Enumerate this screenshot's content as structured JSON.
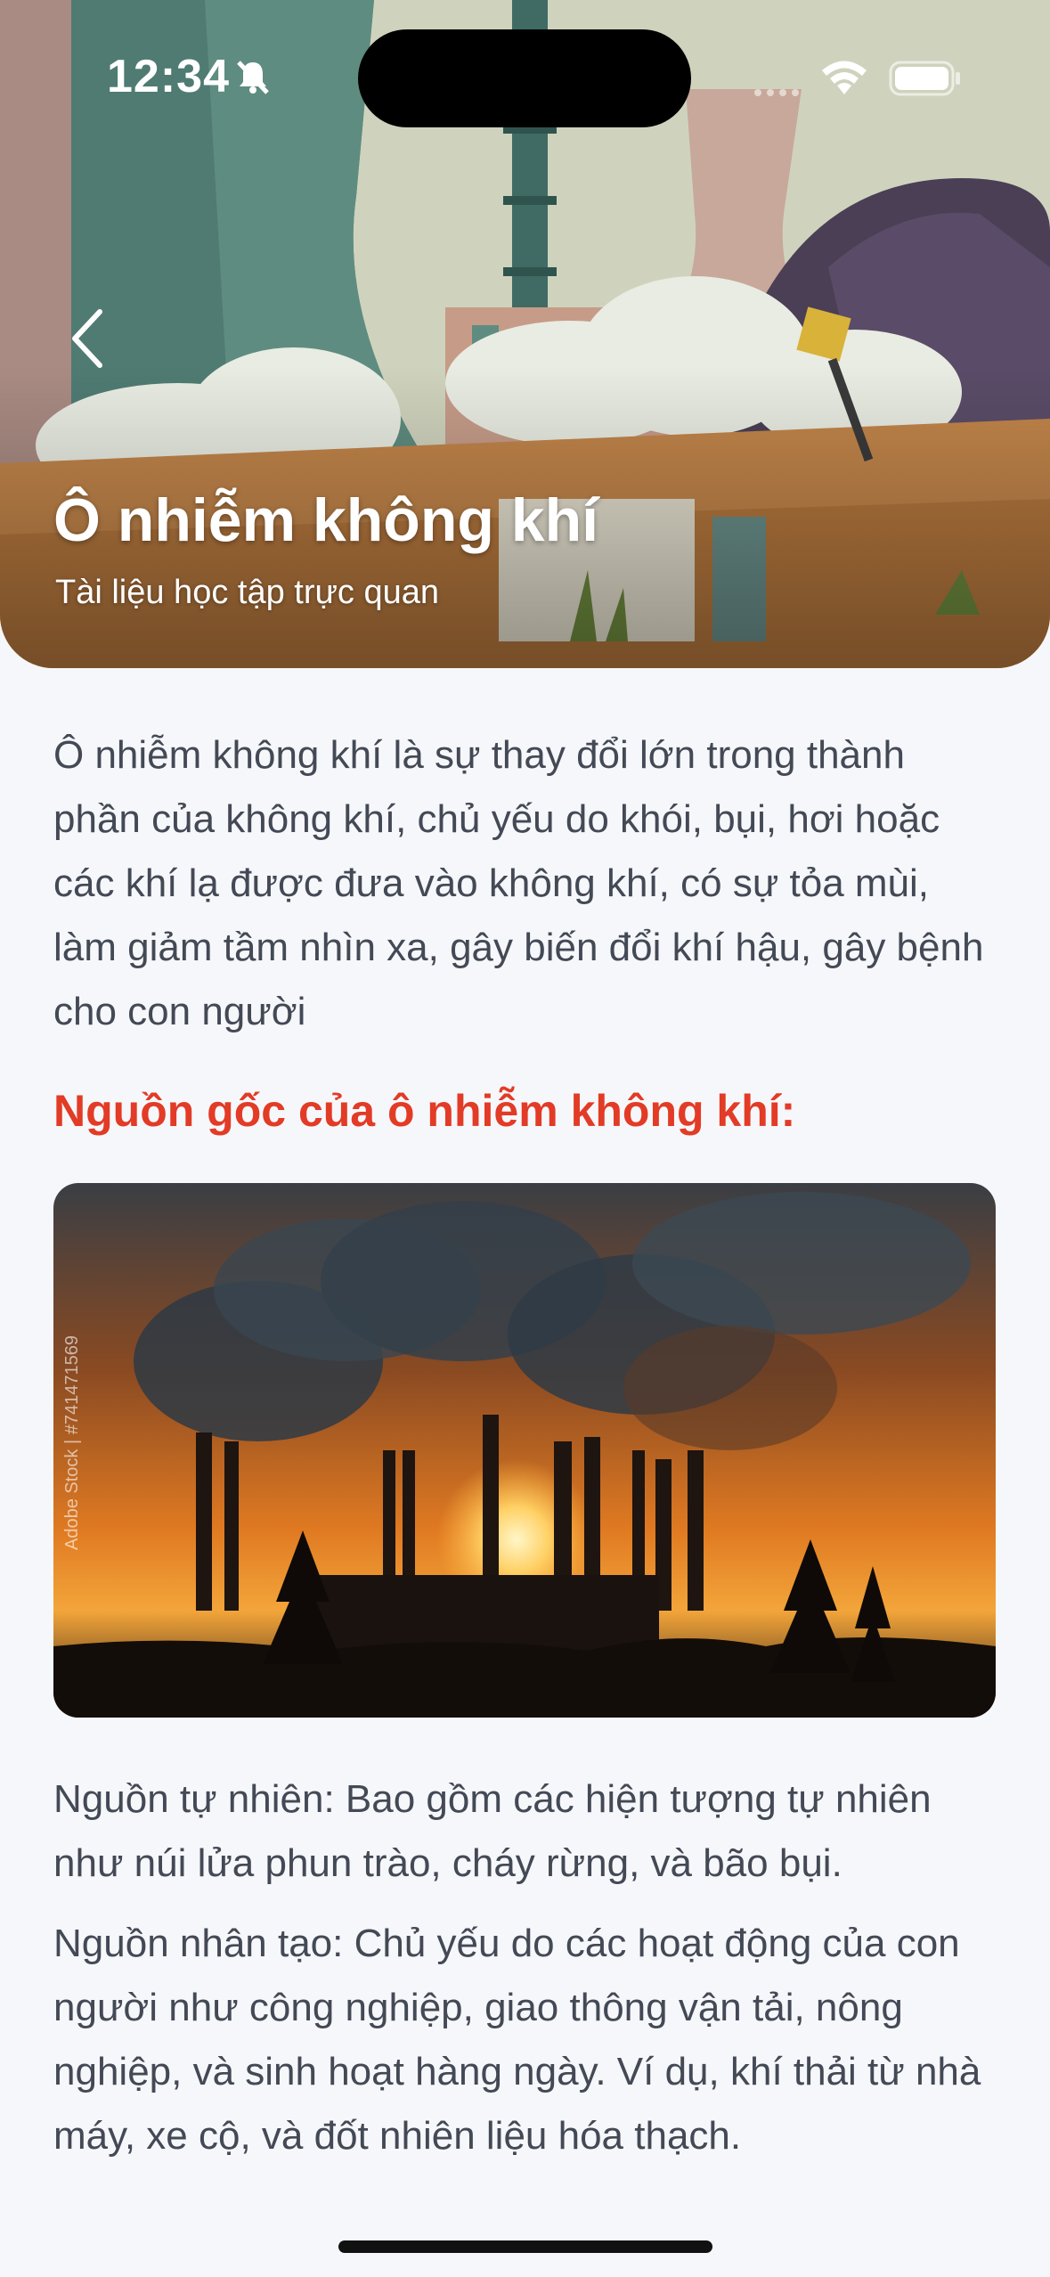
{
  "status_bar": {
    "time": "12:34",
    "icons": [
      "bell-slash-icon",
      "cellular-signal-icon",
      "wifi-icon",
      "battery-icon"
    ]
  },
  "header": {
    "back_icon": "chevron-left-icon",
    "title": "Ô nhiễm không khí",
    "subtitle": "Tài liệu học tập trực quan"
  },
  "article": {
    "intro": "Ô nhiễm không khí là sự thay đổi lớn trong thành phần của không khí, chủ yếu do khói, bụi, hơi hoặc các khí lạ được đưa vào không khí, có sự tỏa mùi, làm giảm tầm nhìn xa, gây biến đổi khí hậu, gây bệnh cho con người",
    "section_heading": "Nguồn gốc của ô nhiễm không khí:",
    "image_watermark": "Adobe Stock | #741471569",
    "natural_sources": "Nguồn tự nhiên: Bao gồm các hiện tượng tự nhiên như núi lửa phun trào, cháy rừng, và bão bụi.",
    "human_sources": "Nguồn nhân tạo: Chủ yếu do các hoạt động của con người như công nghiệp, giao thông vận tải, nông nghiệp, và sinh hoạt hàng ngày. Ví dụ, khí thải từ nhà máy, xe cộ, và đốt nhiên liệu hóa thạch."
  },
  "colors": {
    "accent_heading": "#e23b26",
    "body_text": "#434955",
    "background": "#f6f7fa"
  }
}
